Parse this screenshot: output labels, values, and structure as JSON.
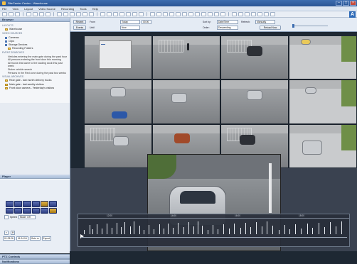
{
  "window": {
    "title": "SiteCenter Center - Warehouse"
  },
  "menu": [
    "File",
    "View",
    "Layout",
    "Video Source",
    "Recording",
    "Tools",
    "Help"
  ],
  "sidebar": {
    "browser_title": "Browser",
    "sections": [
      {
        "name": "LAYOUTS",
        "items": [
          "Warehouse"
        ]
      },
      {
        "name": "VIDEO SOURCES",
        "items": [
          "Cameras",
          "Clips",
          "Storage Devices",
          "Recording Folders"
        ]
      },
      {
        "name": "EVENT SEARCHES",
        "lines": [
          "Vehicles entering the main gate during the past hour",
          "All persons entering the front door this morning",
          "All trucks that came to the loading dock this past week",
          "Stolen vehicle search",
          "Persons in the Red zone during the past two weeks"
        ]
      },
      {
        "name": "VISUAL ARCHIVES",
        "items": [
          "Rear gate - last month delivery trucks",
          "Main gate - last weekly visitors",
          "Front door camera - Yesterday's visitors"
        ]
      }
    ],
    "player_title": "Player",
    "speed_label": "Speed",
    "speed_value": "Mode: Off",
    "start_time": "01:23:26",
    "end_time": "01:24:16",
    "go_label": "Goto m",
    "export_label": "Export",
    "ptz_title": "PTZ Controls",
    "notify_title": "Notifications"
  },
  "search": {
    "recent_label": "Recent",
    "from_label": "From",
    "from_value": "Today",
    "from_time": "00:00",
    "events_label": "Events",
    "until_label": "Until",
    "until_value": "Now",
    "sort_label": "Sort by:",
    "sort_value": "Date/Time",
    "order_label": "Order:",
    "order_value": "Descending",
    "refresh_label": "Refresh:",
    "refresh_value": "Manually",
    "reload_label": "Reload Now"
  },
  "timeline": {
    "ticks": [
      "12:00",
      "14:00",
      "16:00",
      "18:00"
    ]
  },
  "colors": {
    "titlebar": "#2a5594",
    "accent": "#3d6db0",
    "folder": "#f1c34d"
  },
  "icons": [
    "app-icon",
    "folder-icon",
    "play-icon",
    "logo-icon"
  ]
}
